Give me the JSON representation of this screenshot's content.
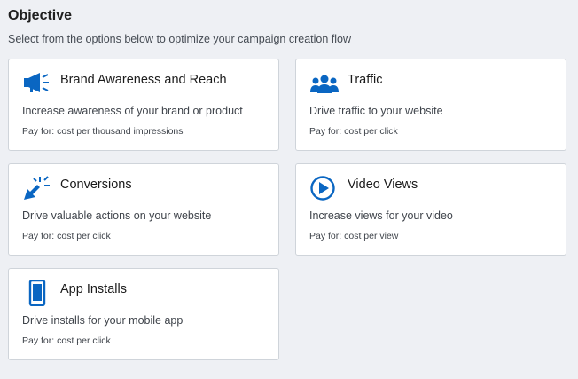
{
  "header": {
    "title": "Objective",
    "subtitle": "Select from the options below to optimize your campaign creation flow"
  },
  "colors": {
    "accent": "#0a66c2",
    "card_border": "#cfd4da",
    "background": "#eef0f4"
  },
  "objectives": [
    {
      "icon": "megaphone-icon",
      "title": "Brand Awareness and Reach",
      "description": "Increase awareness of your brand or product",
      "pay_for": "Pay for: cost per thousand impressions"
    },
    {
      "icon": "people-icon",
      "title": "Traffic",
      "description": "Drive traffic to your website",
      "pay_for": "Pay for: cost per click"
    },
    {
      "icon": "cursor-click-icon",
      "title": "Conversions",
      "description": "Drive valuable actions on your website",
      "pay_for": "Pay for: cost per click"
    },
    {
      "icon": "play-circle-icon",
      "title": "Video Views",
      "description": "Increase views for your video",
      "pay_for": "Pay for: cost per view"
    },
    {
      "icon": "mobile-phone-icon",
      "title": "App Installs",
      "description": "Drive installs for your mobile app",
      "pay_for": "Pay for: cost per click"
    }
  ]
}
